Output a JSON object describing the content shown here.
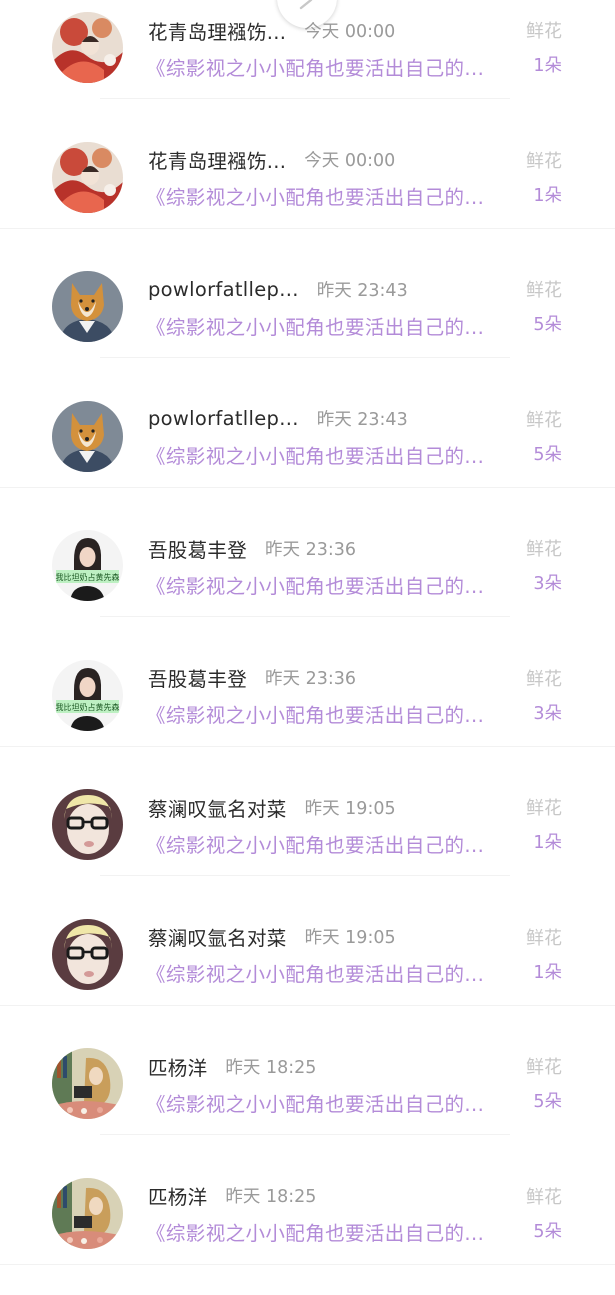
{
  "floating_button": {
    "icon": "chevron-icon"
  },
  "rows": [
    {
      "name": "花青岛理襁饬...",
      "time": "今天 00:00",
      "book": "《综影视之小小配角也要活出自己的...",
      "type": "鲜花",
      "count": "1朵",
      "avatar": "avatar-fantasy-art"
    },
    {
      "name": "花青岛理襁饬...",
      "time": "今天 00:00",
      "book": "《综影视之小小配角也要活出自己的...",
      "type": "鲜花",
      "count": "1朵",
      "avatar": "avatar-fantasy-art"
    },
    {
      "name": "powlorfatllep...",
      "time": "昨天 23:43",
      "book": "《综影视之小小配角也要活出自己的...",
      "type": "鲜花",
      "count": "5朵",
      "avatar": "avatar-shiba-dog"
    },
    {
      "name": "powlorfatllep...",
      "time": "昨天 23:43",
      "book": "《综影视之小小配角也要活出自己的...",
      "type": "鲜花",
      "count": "5朵",
      "avatar": "avatar-shiba-dog"
    },
    {
      "name": "吾股葛丰登",
      "time": "昨天 23:36",
      "book": "《综影视之小小配角也要活出自己的...",
      "type": "鲜花",
      "count": "3朵",
      "avatar": "avatar-girl-sign"
    },
    {
      "name": "吾股葛丰登",
      "time": "昨天 23:36",
      "book": "《综影视之小小配角也要活出自己的...",
      "type": "鲜花",
      "count": "3朵",
      "avatar": "avatar-girl-sign"
    },
    {
      "name": "蔡澜叹氩名对菜",
      "time": "昨天 19:05",
      "book": "《综影视之小小配角也要活出自己的...",
      "type": "鲜花",
      "count": "1朵",
      "avatar": "avatar-glasses-man"
    },
    {
      "name": "蔡澜叹氩名对菜",
      "time": "昨天 19:05",
      "book": "《综影视之小小配角也要活出自己的...",
      "type": "鲜花",
      "count": "1朵",
      "avatar": "avatar-glasses-man"
    },
    {
      "name": "匹杨洋",
      "time": "昨天 18:25",
      "book": "《综影视之小小配角也要活出自己的...",
      "type": "鲜花",
      "count": "5朵",
      "avatar": "avatar-girl-reading"
    },
    {
      "name": "匹杨洋",
      "time": "昨天 18:25",
      "book": "《综影视之小小配角也要活出自己的...",
      "type": "鲜花",
      "count": "5朵",
      "avatar": "avatar-girl-reading"
    }
  ]
}
